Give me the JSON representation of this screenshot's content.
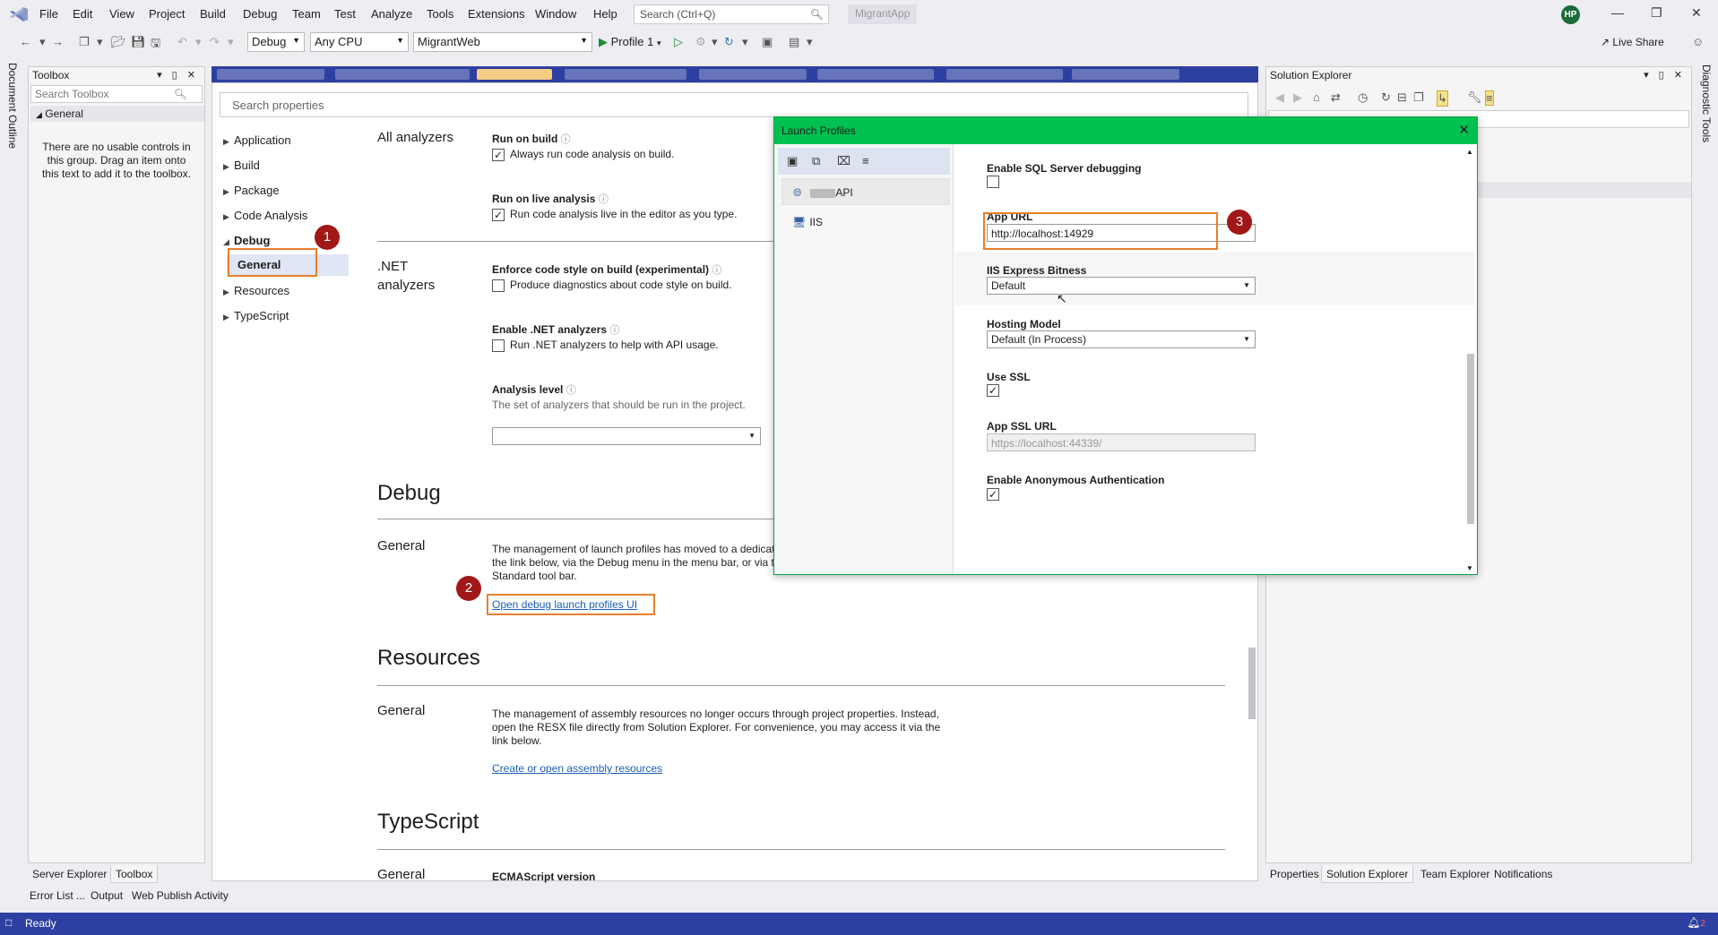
{
  "menubar": {
    "items": [
      "File",
      "Edit",
      "View",
      "Project",
      "Build",
      "Debug",
      "Team",
      "Test",
      "Analyze",
      "Tools",
      "Extensions",
      "Window",
      "Help"
    ],
    "search_placeholder": "Search (Ctrl+Q)",
    "app_name": "MigrantApp",
    "avatar_initials": "HP"
  },
  "toolbar": {
    "config": "Debug",
    "platform": "Any CPU",
    "startup_project": "MigrantWeb",
    "profile_label": "Profile 1",
    "live_share": "Live Share"
  },
  "left_rail": {
    "doc_outline": "Document Outline"
  },
  "right_rail": {
    "diagnostic_tools": "Diagnostic Tools"
  },
  "toolbox": {
    "title": "Toolbox",
    "search_placeholder": "Search Toolbox",
    "group": "General",
    "empty_message": "There are no usable controls in this group. Drag an item onto this text to add it to the toolbox.",
    "tabs": [
      "Server Explorer",
      "Toolbox"
    ]
  },
  "properties": {
    "search_placeholder": "Search properties",
    "nav": [
      "Application",
      "Build",
      "Package",
      "Code Analysis",
      "Debug",
      "Resources",
      "TypeScript"
    ],
    "nav_child": "General",
    "sections": {
      "all_analyzers": "All analyzers",
      "net_analyzers_line1": ".NET",
      "net_analyzers_line2": "analyzers",
      "debug": "Debug",
      "resources": "Resources",
      "typescript": "TypeScript",
      "general": "General"
    },
    "run_on_build": {
      "label": "Run on build",
      "check": "Always run code analysis on build."
    },
    "run_on_live": {
      "label": "Run on live analysis",
      "check": "Run code analysis live in the editor as you type."
    },
    "enforce_style": {
      "label": "Enforce code style on build (experimental)",
      "check": "Produce diagnostics about code style on build."
    },
    "enable_net": {
      "label": "Enable .NET analyzers",
      "check": "Run .NET analyzers to help with API usage."
    },
    "analysis_level": {
      "label": "Analysis level",
      "desc": "The set of analyzers that should be run in the project."
    },
    "debug_desc_1": "The management of launch profiles has moved to a dedicat",
    "debug_desc_2": "the link below, via the Debug menu in the menu bar, or via t",
    "debug_desc_3": "Standard tool bar.",
    "debug_link": "Open debug launch profiles UI",
    "resources_desc_1": "The management of assembly resources no longer occurs through project properties. Instead,",
    "resources_desc_2": "open the RESX file directly from Solution Explorer. For convenience, you may access it via the",
    "resources_desc_3": "link below.",
    "resources_link": "Create or open assembly resources",
    "ecmascript": "ECMAScript version"
  },
  "badges": [
    "1",
    "2",
    "3"
  ],
  "solution_explorer": {
    "title": "Solution Explorer",
    "tabs": [
      "Properties",
      "Solution Explorer",
      "Team Explorer",
      "Notifications"
    ]
  },
  "bottom_tabs": [
    "Error List ...",
    "Output",
    "Web Publish Activity"
  ],
  "status": {
    "text": "Ready",
    "notifications": "2"
  },
  "launch_profiles": {
    "title": "Launch Profiles",
    "profiles": [
      "API",
      "IIS"
    ],
    "fields": {
      "sql_debugging": "Enable SQL Server debugging",
      "app_url_label": "App URL",
      "app_url_value": "http://localhost:14929",
      "bitness_label": "IIS Express Bitness",
      "bitness_value": "Default",
      "hosting_label": "Hosting Model",
      "hosting_value": "Default (In Process)",
      "ssl_label": "Use SSL",
      "ssl_url_label": "App SSL URL",
      "ssl_url_value": "https://localhost:44339/",
      "anon_auth_label": "Enable Anonymous Authentication"
    }
  },
  "colors": {
    "accent_blue": "#2d3fa0",
    "dialog_header": "#00c050",
    "highlight_box": "#e8802c",
    "badge": "#a01818",
    "link": "#1a5fb4"
  }
}
